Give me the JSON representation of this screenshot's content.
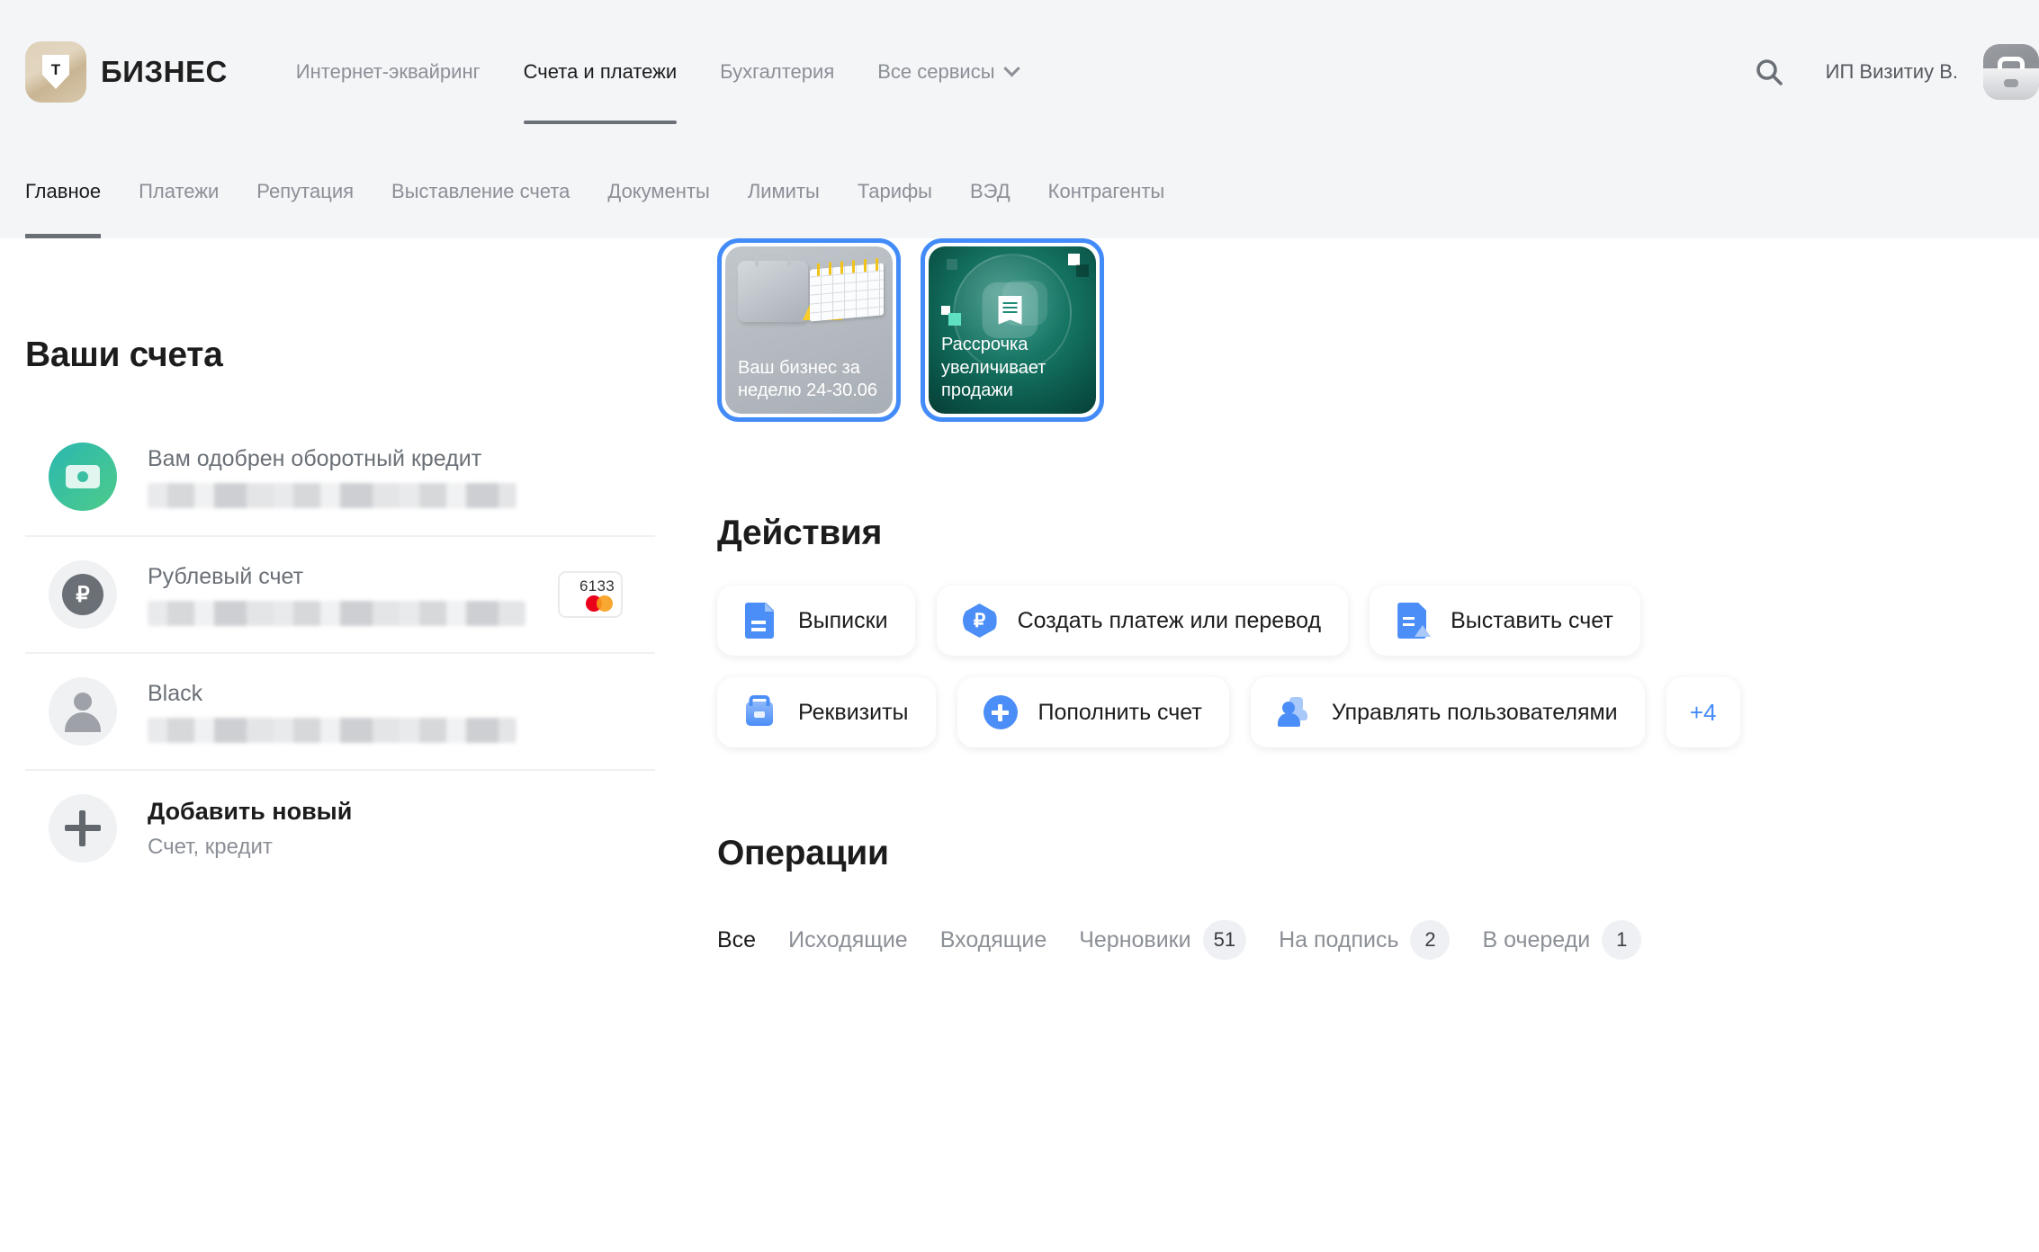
{
  "header": {
    "brand": {
      "logo_letter": "Т",
      "name": "БИЗНЕС"
    },
    "nav": [
      {
        "label": "Интернет-эквайринг",
        "active": false
      },
      {
        "label": "Счета и платежи",
        "active": true
      },
      {
        "label": "Бухгалтерия",
        "active": false
      },
      {
        "label": "Все сервисы",
        "active": false,
        "has_chevron": true
      }
    ],
    "search_icon": "search-icon",
    "user_name": "ИП Визитиу В.",
    "avatar_icon": "briefcase-avatar-icon"
  },
  "subnav": [
    {
      "label": "Главное",
      "active": true
    },
    {
      "label": "Платежи",
      "active": false
    },
    {
      "label": "Репутация",
      "active": false
    },
    {
      "label": "Выставление счета",
      "active": false
    },
    {
      "label": "Документы",
      "active": false
    },
    {
      "label": "Лимиты",
      "active": false
    },
    {
      "label": "Тарифы",
      "active": false
    },
    {
      "label": "ВЭД",
      "active": false
    },
    {
      "label": "Контрагенты",
      "active": false
    }
  ],
  "accounts": {
    "title": "Ваши счета",
    "items": [
      {
        "name": "Вам одобрен оборотный кредит",
        "icon": "money-bill-icon",
        "balance_hidden": true,
        "card": null
      },
      {
        "name": "Рублевый счет",
        "icon": "ruble-coin-icon",
        "balance_hidden": true,
        "card": {
          "last4": "6133",
          "scheme": "mastercard"
        }
      },
      {
        "name": "Black",
        "icon": "person-icon",
        "balance_hidden": true,
        "card": null
      }
    ],
    "add_new": {
      "title": "Добавить новый",
      "subtitle": "Счет, кредит",
      "icon": "plus-icon"
    }
  },
  "stories": [
    {
      "caption": "Ваш бизнес за неделю 24-30.06",
      "theme": "gray",
      "art": "briefcase-calendar-icon"
    },
    {
      "caption": "Рассрочка увеличивает продажи",
      "theme": "green",
      "art": "receipt-bubble-icon"
    }
  ],
  "actions": {
    "title": "Действия",
    "rows": [
      [
        {
          "label": "Выписки",
          "icon": "statements-doc-icon"
        },
        {
          "label": "Создать платеж или перевод",
          "icon": "ruble-payment-icon"
        },
        {
          "label": "Выставить счет",
          "icon": "invoice-upload-icon"
        }
      ],
      [
        {
          "label": "Реквизиты",
          "icon": "briefcase-details-icon"
        },
        {
          "label": "Пополнить счет",
          "icon": "plus-circle-icon"
        },
        {
          "label": "Управлять пользователями",
          "icon": "users-icon"
        }
      ]
    ],
    "more_label": "+4"
  },
  "operations": {
    "title": "Операции",
    "tabs": [
      {
        "label": "Все",
        "badge": null,
        "active": true
      },
      {
        "label": "Исходящие",
        "badge": null,
        "active": false
      },
      {
        "label": "Входящие",
        "badge": null,
        "active": false
      },
      {
        "label": "Черновики",
        "badge": "51",
        "active": false
      },
      {
        "label": "На подпись",
        "badge": "2",
        "active": false
      },
      {
        "label": "В очереди",
        "badge": "1",
        "active": false
      }
    ]
  },
  "colors": {
    "accent_blue": "#428bf9",
    "header_bg": "#f4f5f7",
    "text_primary": "#1c1c1c",
    "text_muted": "#8b8f96",
    "credit_gradient_start": "#2ab8b0",
    "credit_gradient_end": "#4ecb8a",
    "story_green": "#14705f",
    "badge_bg": "#eef0f3"
  }
}
